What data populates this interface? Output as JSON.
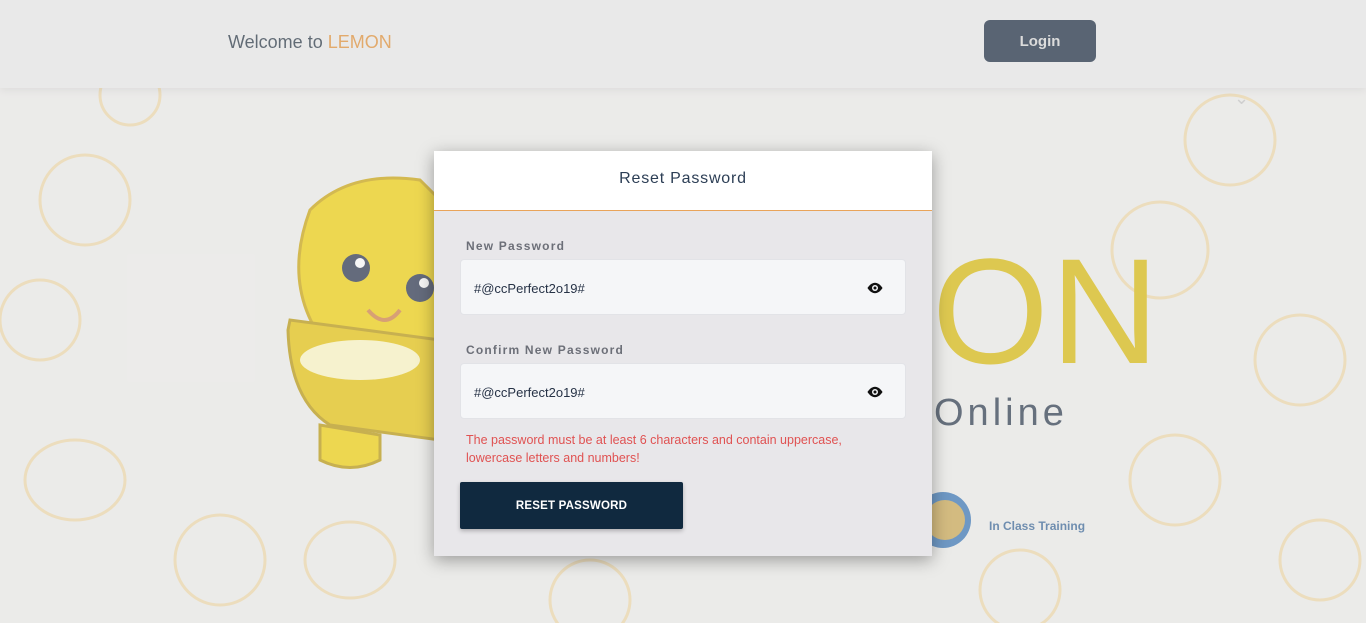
{
  "header": {
    "welcome_prefix": "Welcome to ",
    "brand": "LEMON",
    "login_label": "Login"
  },
  "background": {
    "big_text": "ON",
    "online_text": "Online",
    "training_label": "In Class Training"
  },
  "modal": {
    "title": "Reset Password",
    "new_password": {
      "label": "New Password",
      "value": "#@ccPerfect2o19#"
    },
    "confirm_password": {
      "label": "Confirm New Password",
      "value": "#@ccPerfect2o19#"
    },
    "error": "The password must be at least 6 characters and contain uppercase, lowercase letters and numbers!",
    "reset_label": "RESET PASSWORD"
  },
  "colors": {
    "navy": "#10293f",
    "brand_orange": "#e08a2c",
    "error_red": "#e05252",
    "lemon_yellow": "#d9b800"
  },
  "icons": [
    "eye-icon",
    "eye-icon",
    "chevron-down-icon",
    "lemon-mascot",
    "in-class-training-icon"
  ]
}
